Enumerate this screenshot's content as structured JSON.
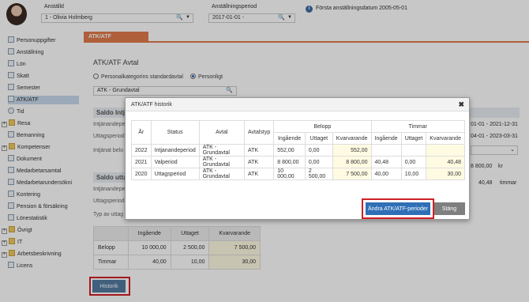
{
  "header": {
    "employee_label": "Anställd",
    "employee_value": "1 - Olivia Holmberg",
    "period_label": "Anställningsperiod",
    "period_value": "2017-01-01 -",
    "first_employment": "Första anställningsdatum 2005-05-01"
  },
  "sidebar": {
    "items": [
      {
        "label": "Personuppgifter"
      },
      {
        "label": "Anställning"
      },
      {
        "label": "Lön"
      },
      {
        "label": "Skatt"
      },
      {
        "label": "Semester"
      },
      {
        "label": "ATK/ATF"
      },
      {
        "label": "Tid"
      },
      {
        "label": "Resa"
      },
      {
        "label": "Bemanning"
      },
      {
        "label": "Kompetenser"
      },
      {
        "label": "Dokument"
      },
      {
        "label": "Medarbetarsamtal"
      },
      {
        "label": "Medarbetarundersökni"
      },
      {
        "label": "Kontering"
      },
      {
        "label": "Pension & försäkring"
      },
      {
        "label": "Lönestatistik"
      },
      {
        "label": "Övrigt"
      },
      {
        "label": "IT"
      },
      {
        "label": "Arbetsbeskrivning"
      },
      {
        "label": "Licens"
      }
    ]
  },
  "tab": {
    "label": "ATK/ATF"
  },
  "main": {
    "title": "ATK/ATF Avtal",
    "radio_standard": "Personalkategorins standardavtal",
    "radio_personal": "Personligt",
    "agreement_value": "ATK - Grundavtal",
    "section1": "Saldo Intj",
    "intj_label": "Intjänandepe",
    "uttag_label": "Uttagsperiod",
    "intj_belopp_label": "Intjänat belo",
    "section2": "Saldo utta",
    "intj_label2": "Intjänandepe",
    "uttag_label2": "Uttagsperiod",
    "typ_label": "Typ av uttag",
    "right_date1": "01-01 - 2021-12-31",
    "right_date2": "04-01 - 2023-03-31",
    "right_amount": "8 800,00",
    "right_amount_unit": "kr",
    "right_hours": "40,48",
    "right_hours_unit": "timmar",
    "historik_label": "Historik"
  },
  "summary": {
    "headers": [
      "Ingående",
      "Uttaget",
      "Kvarvarande"
    ],
    "rows": [
      {
        "label": "Belopp",
        "ingaende": "10 000,00",
        "uttaget": "2 500,00",
        "kvarvarande": "7 500,00"
      },
      {
        "label": "Timmar",
        "ingaende": "40,00",
        "uttaget": "10,00",
        "kvarvarande": "30,00"
      }
    ]
  },
  "modal": {
    "title": "ATK/ATF historik",
    "col_ar": "År",
    "col_status": "Status",
    "col_avtal": "Avtal",
    "col_avtalstyp": "Avtalstyp",
    "group_belopp": "Belopp",
    "group_timmar": "Timmar",
    "sub_ingaende": "Ingående",
    "sub_uttaget": "Uttaget",
    "sub_kvarvarande": "Kvarvarande",
    "rows": [
      {
        "ar": "2022",
        "status": "Intjanandeperiod",
        "avtal": "ATK - Grundavtal",
        "typ": "ATK",
        "b_in": "552,00",
        "b_ut": "0,00",
        "b_kv": "552,00",
        "t_in": "",
        "t_ut": "",
        "t_kv": ""
      },
      {
        "ar": "2021",
        "status": "Valperiod",
        "avtal": "ATK - Grundavtal",
        "typ": "ATK",
        "b_in": "8 800,00",
        "b_ut": "0,00",
        "b_kv": "8 800,00",
        "t_in": "40,48",
        "t_ut": "0,00",
        "t_kv": "40,48"
      },
      {
        "ar": "2020",
        "status": "Uttagsperiod",
        "avtal": "ATK - Grundavtal",
        "typ": "ATK",
        "b_in": "10 000,00",
        "b_ut": "2 500,00",
        "b_kv": "7 500,00",
        "t_in": "40,00",
        "t_ut": "10,00",
        "t_kv": "30,00"
      }
    ],
    "andra_button": "Ändra ATK/ATF-perioder",
    "stang_button": "Stäng"
  },
  "colors": {
    "accent": "#e07a4b",
    "button_blue": "#2f6fb6",
    "highlight": "#d21f26"
  }
}
